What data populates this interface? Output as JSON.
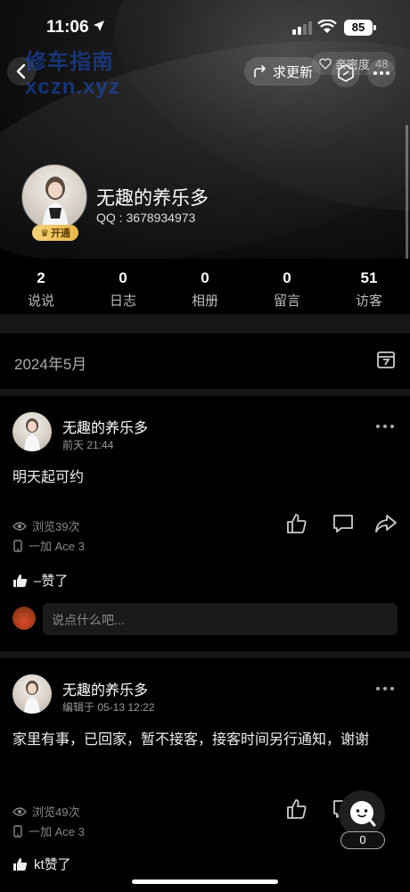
{
  "status_bar": {
    "time": "11:06",
    "battery": "85"
  },
  "header": {
    "watermark_line1": "修车指南",
    "watermark_line2": "xczn.xyz",
    "request_update_label": "求更新",
    "intimacy_label": "亲密度",
    "intimacy_value": "48"
  },
  "profile": {
    "name": "无趣的养乐多",
    "qq": "QQ : 3678934973",
    "badge": "开通"
  },
  "stats": [
    {
      "value": "2",
      "label": "说说"
    },
    {
      "value": "0",
      "label": "日志"
    },
    {
      "value": "0",
      "label": "相册"
    },
    {
      "value": "0",
      "label": "留言"
    },
    {
      "value": "51",
      "label": "访客"
    }
  ],
  "month": "2024年5月",
  "posts": [
    {
      "author": "无趣的养乐多",
      "time": "前天 21:44",
      "text": "明天起可约",
      "views": "浏览39次",
      "device": "一加 Ace 3",
      "likes": "–赞了",
      "comment_placeholder": "说点什么吧..."
    },
    {
      "author": "无趣的养乐多",
      "time": "编辑于 05-13 12:22",
      "text": "家里有事，已回家，暂不接客，接客时间另行通知，谢谢",
      "views": "浏览49次",
      "device": "一加 Ace 3",
      "likes": "kt赞了"
    }
  ],
  "bubble": {
    "count": "0"
  },
  "colors": {
    "background": "#000000",
    "accent_gold": "#e8b54a"
  }
}
